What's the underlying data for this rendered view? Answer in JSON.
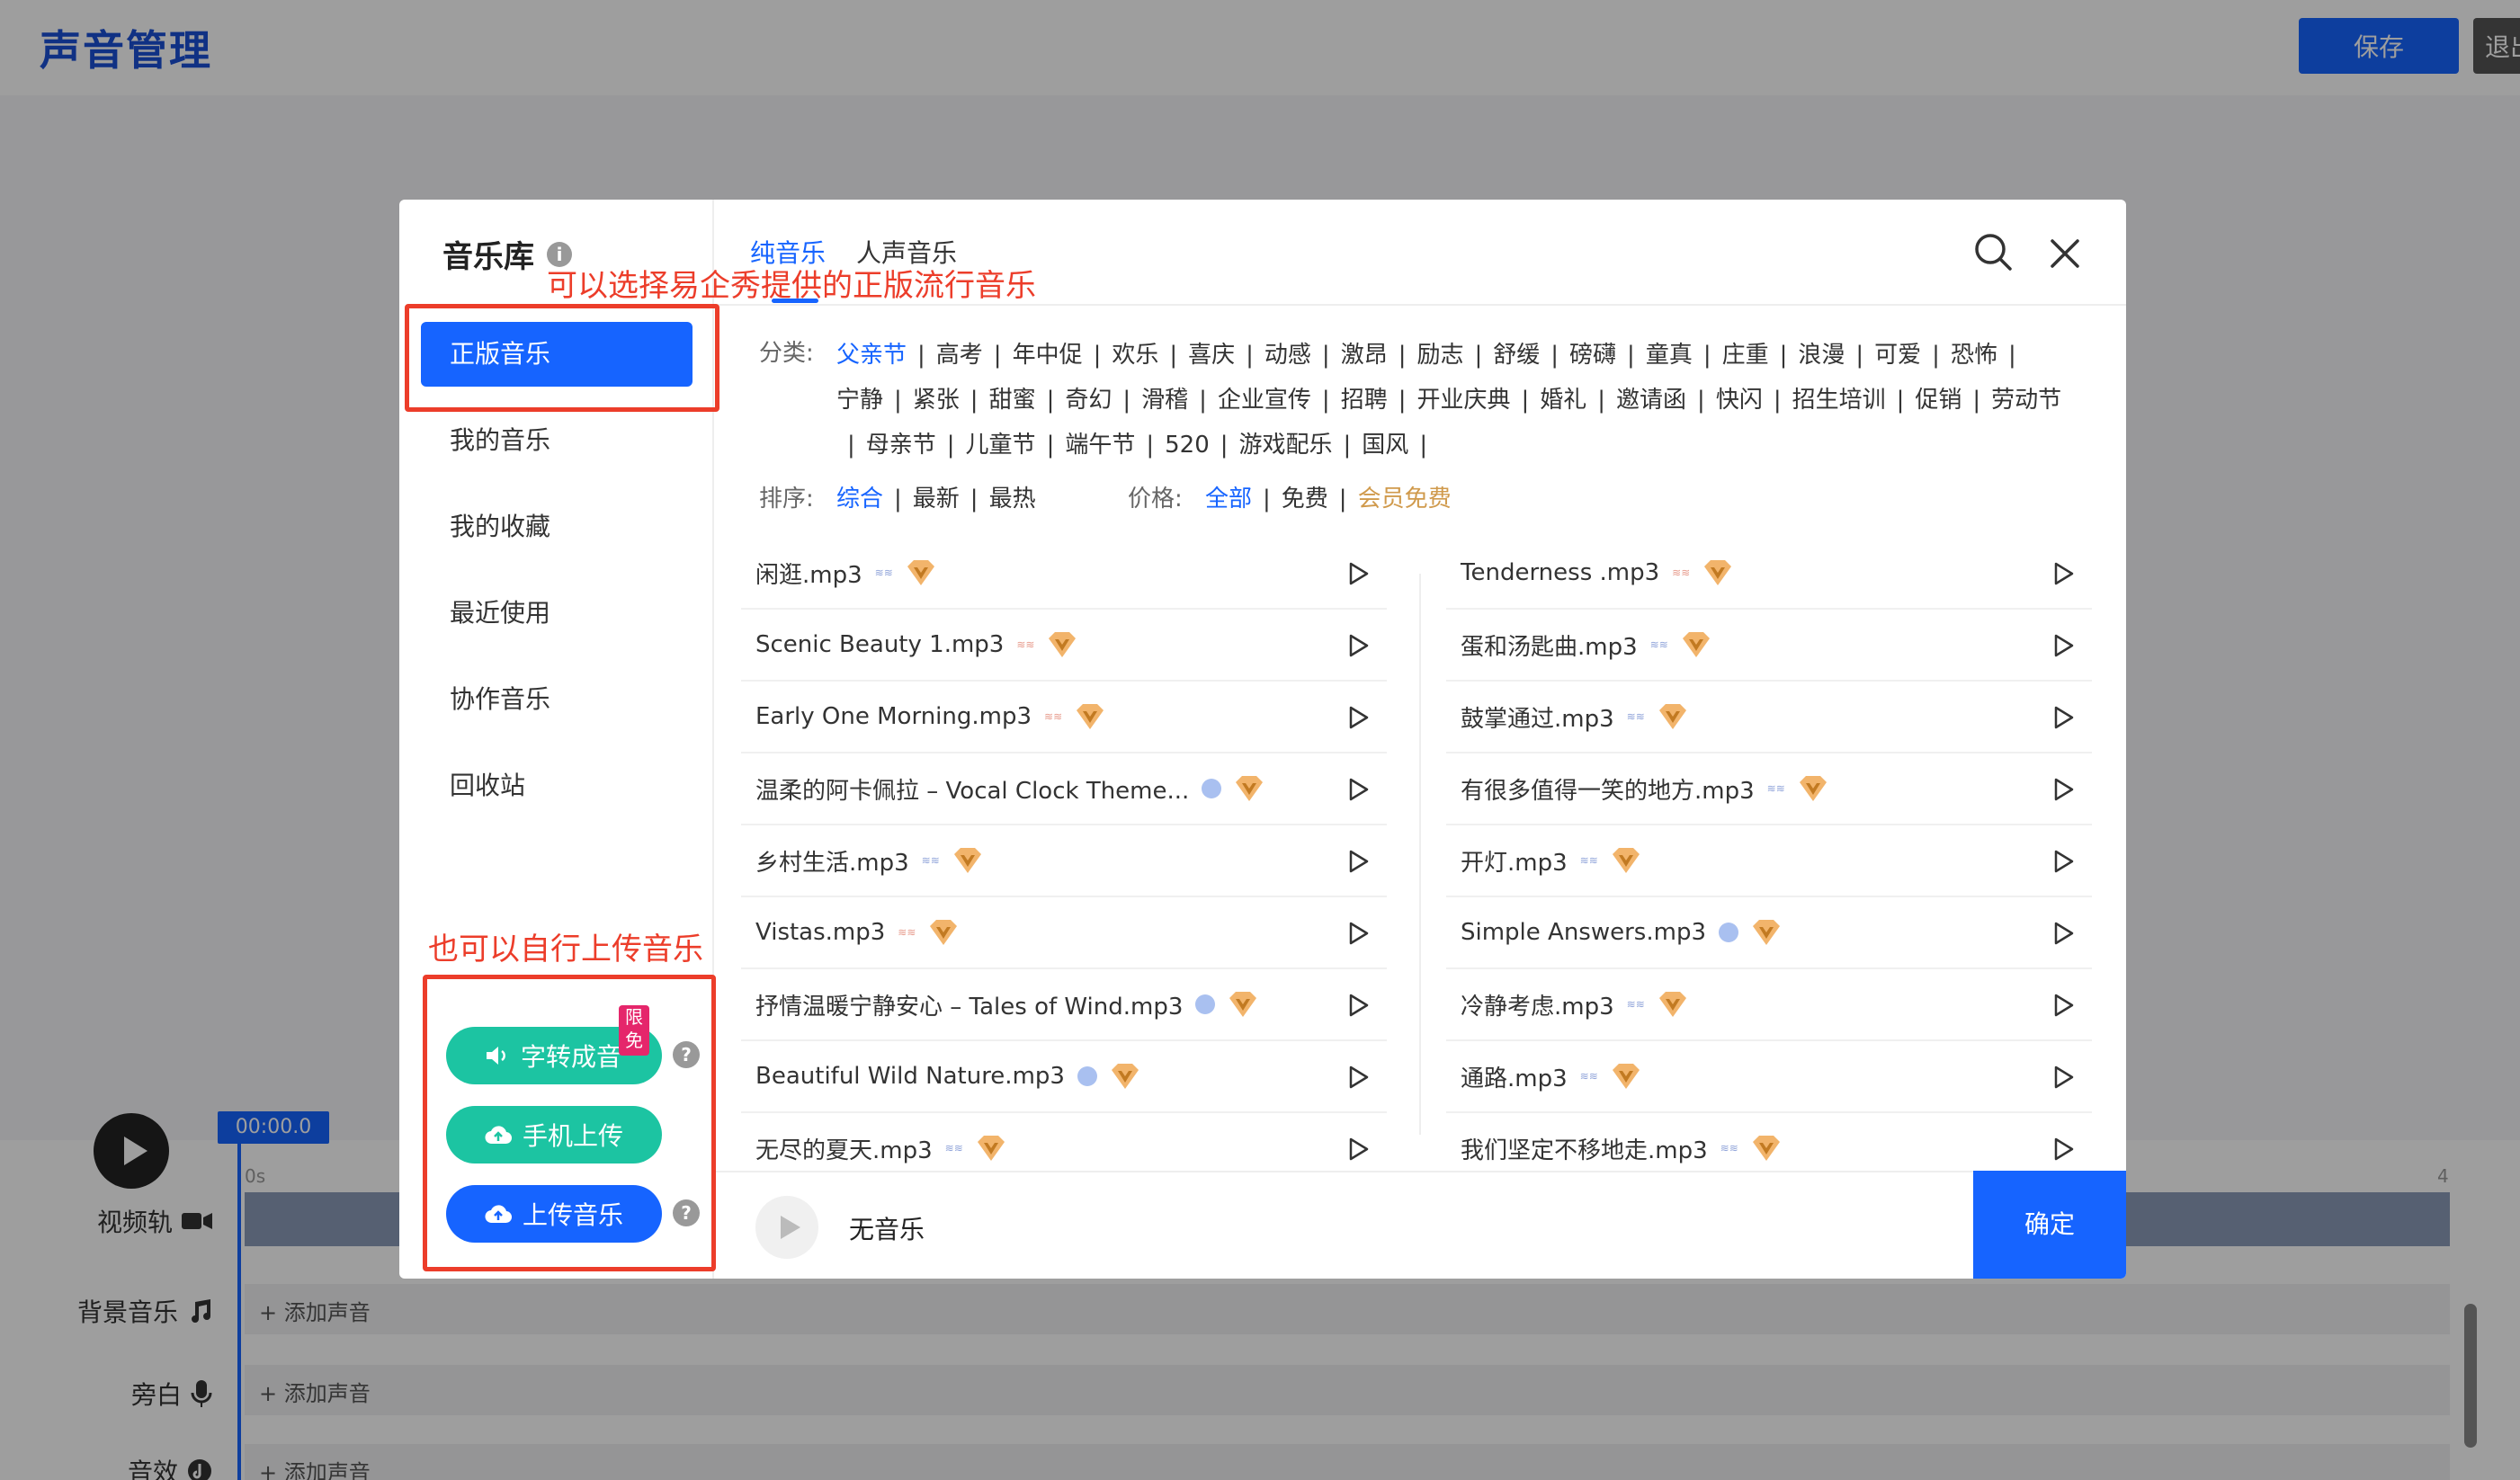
{
  "app": {
    "title": "声音管理",
    "save_label": "保存",
    "exit_label": "退出"
  },
  "timeline": {
    "time": "00:00.0",
    "ruler_start": "0s",
    "ruler_end": "4",
    "tracks": [
      {
        "label": "视频轨",
        "icon": "video-camera-icon"
      },
      {
        "label": "背景音乐",
        "icon": "music-note-icon",
        "add": "+ 添加声音"
      },
      {
        "label": "旁白",
        "icon": "microphone-icon",
        "add": "+ 添加声音"
      },
      {
        "label": "音效",
        "icon": "sound-effect-icon",
        "add": "+ 添加声音"
      }
    ]
  },
  "modal": {
    "title": "音乐库",
    "sidebar": [
      {
        "label": "正版音乐",
        "active": true
      },
      {
        "label": "我的音乐"
      },
      {
        "label": "我的收藏"
      },
      {
        "label": "最近使用"
      },
      {
        "label": "协作音乐"
      },
      {
        "label": "回收站"
      }
    ],
    "actions": {
      "tts": "字转成音",
      "tts_badge": "限免",
      "mobile_upload": "手机上传",
      "upload": "上传音乐"
    },
    "tabs": [
      "纯音乐",
      "人声音乐"
    ],
    "filter_label": "分类:",
    "categories": [
      "父亲节",
      "高考",
      "年中促",
      "欢乐",
      "喜庆",
      "动感",
      "激昂",
      "励志",
      "舒缓",
      "磅礴",
      "童真",
      "庄重",
      "浪漫",
      "可爱",
      "恐怖",
      "宁静",
      "紧张",
      "甜蜜",
      "奇幻",
      "滑稽",
      "企业宣传",
      "招聘",
      "开业庆典",
      "婚礼",
      "邀请函",
      "快闪",
      "招生培训",
      "促销",
      "劳动节",
      "母亲节",
      "儿童节",
      "端午节",
      "520",
      "游戏配乐",
      "国风"
    ],
    "sort_label": "排序:",
    "sort_options": [
      "综合",
      "最新",
      "最热"
    ],
    "price_label": "价格:",
    "price_options": [
      "全部",
      "免费",
      "会员免费"
    ],
    "songs_left": [
      "闲逛.mp3",
      "Scenic Beauty 1.mp3",
      "Early One Morning.mp3",
      "温柔的阿卡佩拉 – Vocal Clock Theme...",
      "乡村生活.mp3",
      "Vistas.mp3",
      "抒情温暖宁静安心 – Tales of Wind.mp3",
      "Beautiful Wild Nature.mp3",
      "无尽的夏天.mp3"
    ],
    "songs_right": [
      "Tenderness .mp3",
      "蛋和汤匙曲.mp3",
      "鼓掌通过.mp3",
      "有很多值得一笑的地方.mp3",
      "开灯.mp3",
      "Simple Answers.mp3",
      "冷静考虑.mp3",
      "通路.mp3",
      "我们坚定不移地走.mp3"
    ],
    "footer_text": "无音乐",
    "confirm": "确定"
  },
  "annotations": {
    "top": "可以选择易企秀提供的正版流行音乐",
    "bottom": "也可以自行上传音乐"
  }
}
